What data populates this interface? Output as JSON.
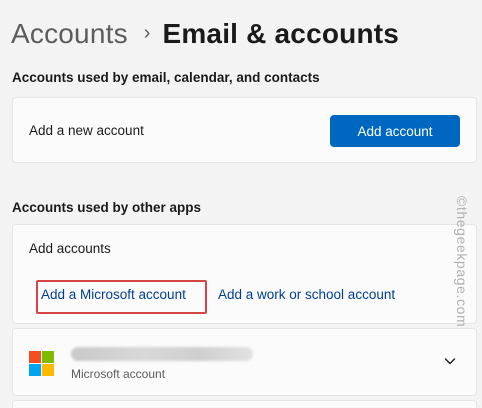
{
  "header": {
    "parent": "Accounts",
    "separator": "›",
    "current": "Email & accounts"
  },
  "section_email": {
    "title": "Accounts used by email, calendar, and contacts",
    "row_label": "Add a new account",
    "button_label": "Add account"
  },
  "section_apps": {
    "title": "Accounts used by other apps",
    "row_label": "Add accounts",
    "link_microsoft": "Add a Microsoft account",
    "link_work": "Add a work or school account"
  },
  "account_entry": {
    "type_label": "Microsoft account",
    "logo_colors": [
      "#f25022",
      "#7fba00",
      "#00a4ef",
      "#ffb900"
    ],
    "expand_icon": "chevron-down-icon"
  },
  "colors": {
    "accent": "#0067c0",
    "link": "#003e92",
    "highlight": "#d64545"
  },
  "watermark": "©thegeekpage.com"
}
